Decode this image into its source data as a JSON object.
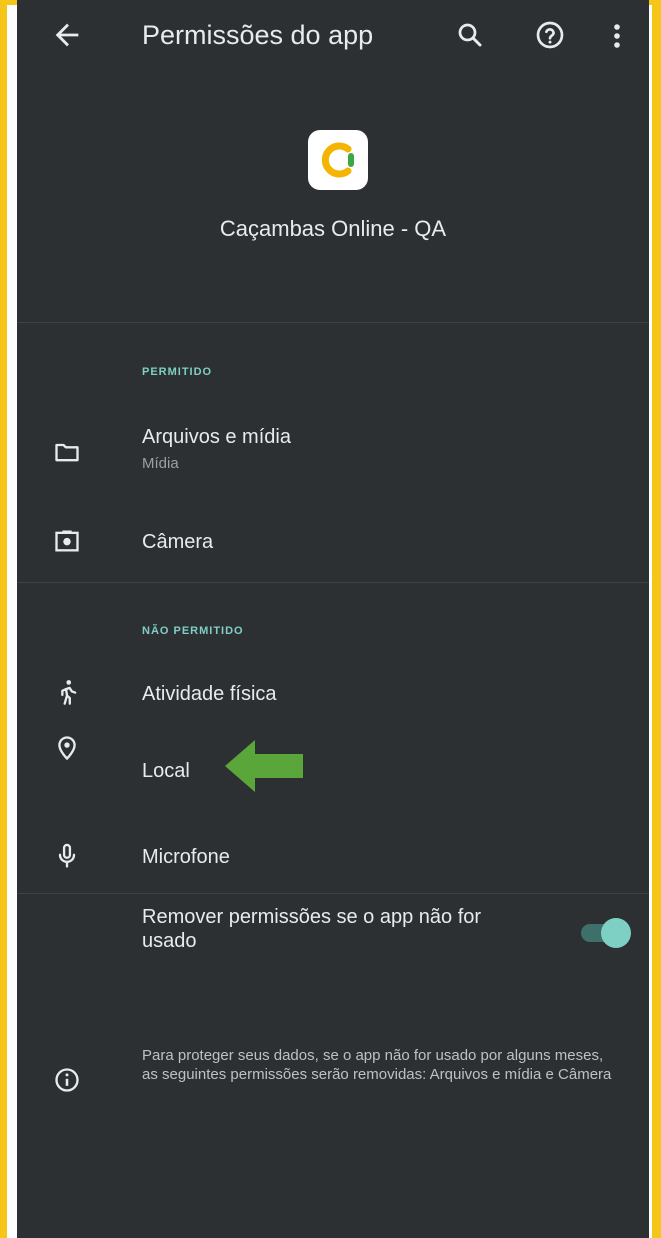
{
  "appbar": {
    "title": "Permissões do app"
  },
  "app": {
    "name": "Caçambas Online - QA"
  },
  "sections": {
    "allowed_label": "PERMITIDO",
    "denied_label": "NÃO PERMITIDO"
  },
  "allowed": [
    {
      "label": "Arquivos e mídia",
      "sub": "Mídia",
      "icon": "folder-icon"
    },
    {
      "label": "Câmera",
      "icon": "camera-icon"
    }
  ],
  "denied": [
    {
      "label": "Atividade física",
      "icon": "walking-icon"
    },
    {
      "label": "Local",
      "icon": "location-pin-icon"
    },
    {
      "label": "Microfone",
      "icon": "microphone-icon"
    }
  ],
  "remove_unused": {
    "label": "Remover permissões se o app não for usado",
    "enabled": true
  },
  "info": {
    "text": "Para proteger seus dados, se o app não for usado por alguns meses, as seguintes permissões serão removidas: Arquivos e mídia e Câmera"
  },
  "colors": {
    "background": "#2d3033",
    "accent": "#7ecfc4",
    "frame": "#f5c518",
    "annotation_arrow": "#5aa63b"
  }
}
